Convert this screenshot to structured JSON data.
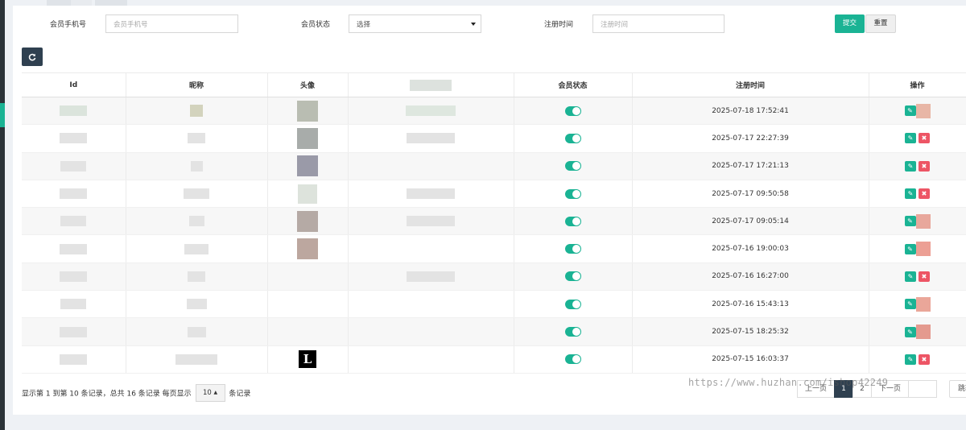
{
  "search": {
    "phone_label": "会员手机号",
    "phone_placeholder": "会员手机号",
    "status_label": "会员状态",
    "status_selected": "选择",
    "regtime_label": "注册时间",
    "regtime_placeholder": "注册时间",
    "submit_label": "提交",
    "reset_label": "重置"
  },
  "table": {
    "headers": [
      "Id",
      "昵称",
      "头像",
      "",
      "会员状态",
      "注册时间",
      "操作"
    ],
    "rows": [
      {
        "reg_time": "2025-07-18 17:52:41"
      },
      {
        "reg_time": "2025-07-17 22:27:39"
      },
      {
        "reg_time": "2025-07-17 17:21:13"
      },
      {
        "reg_time": "2025-07-17 09:50:58"
      },
      {
        "reg_time": "2025-07-17 09:05:14"
      },
      {
        "reg_time": "2025-07-16 19:00:03"
      },
      {
        "reg_time": "2025-07-16 16:27:00"
      },
      {
        "reg_time": "2025-07-16 15:43:13"
      },
      {
        "reg_time": "2025-07-15 18:25:32"
      },
      {
        "reg_time": "2025-07-15 16:03:37"
      }
    ]
  },
  "footer": {
    "info_prefix": "显示第 1 到第 10 条记录，总共 16 条记录 每页显示",
    "page_size": "10",
    "info_suffix": "条记录"
  },
  "pagination": {
    "prev": "上一页",
    "pages": [
      "1",
      "2"
    ],
    "active_page": "1",
    "next": "下一页",
    "jump_label": "跳转"
  },
  "watermark": "https://www.huzhan.com/ishop42249",
  "colors": {
    "primary": "#1ab394",
    "dark": "#2f4050",
    "danger": "#ed5565"
  },
  "icons": {
    "refresh": "refresh-icon",
    "edit": "pencil-icon",
    "delete": "trash-icon"
  }
}
